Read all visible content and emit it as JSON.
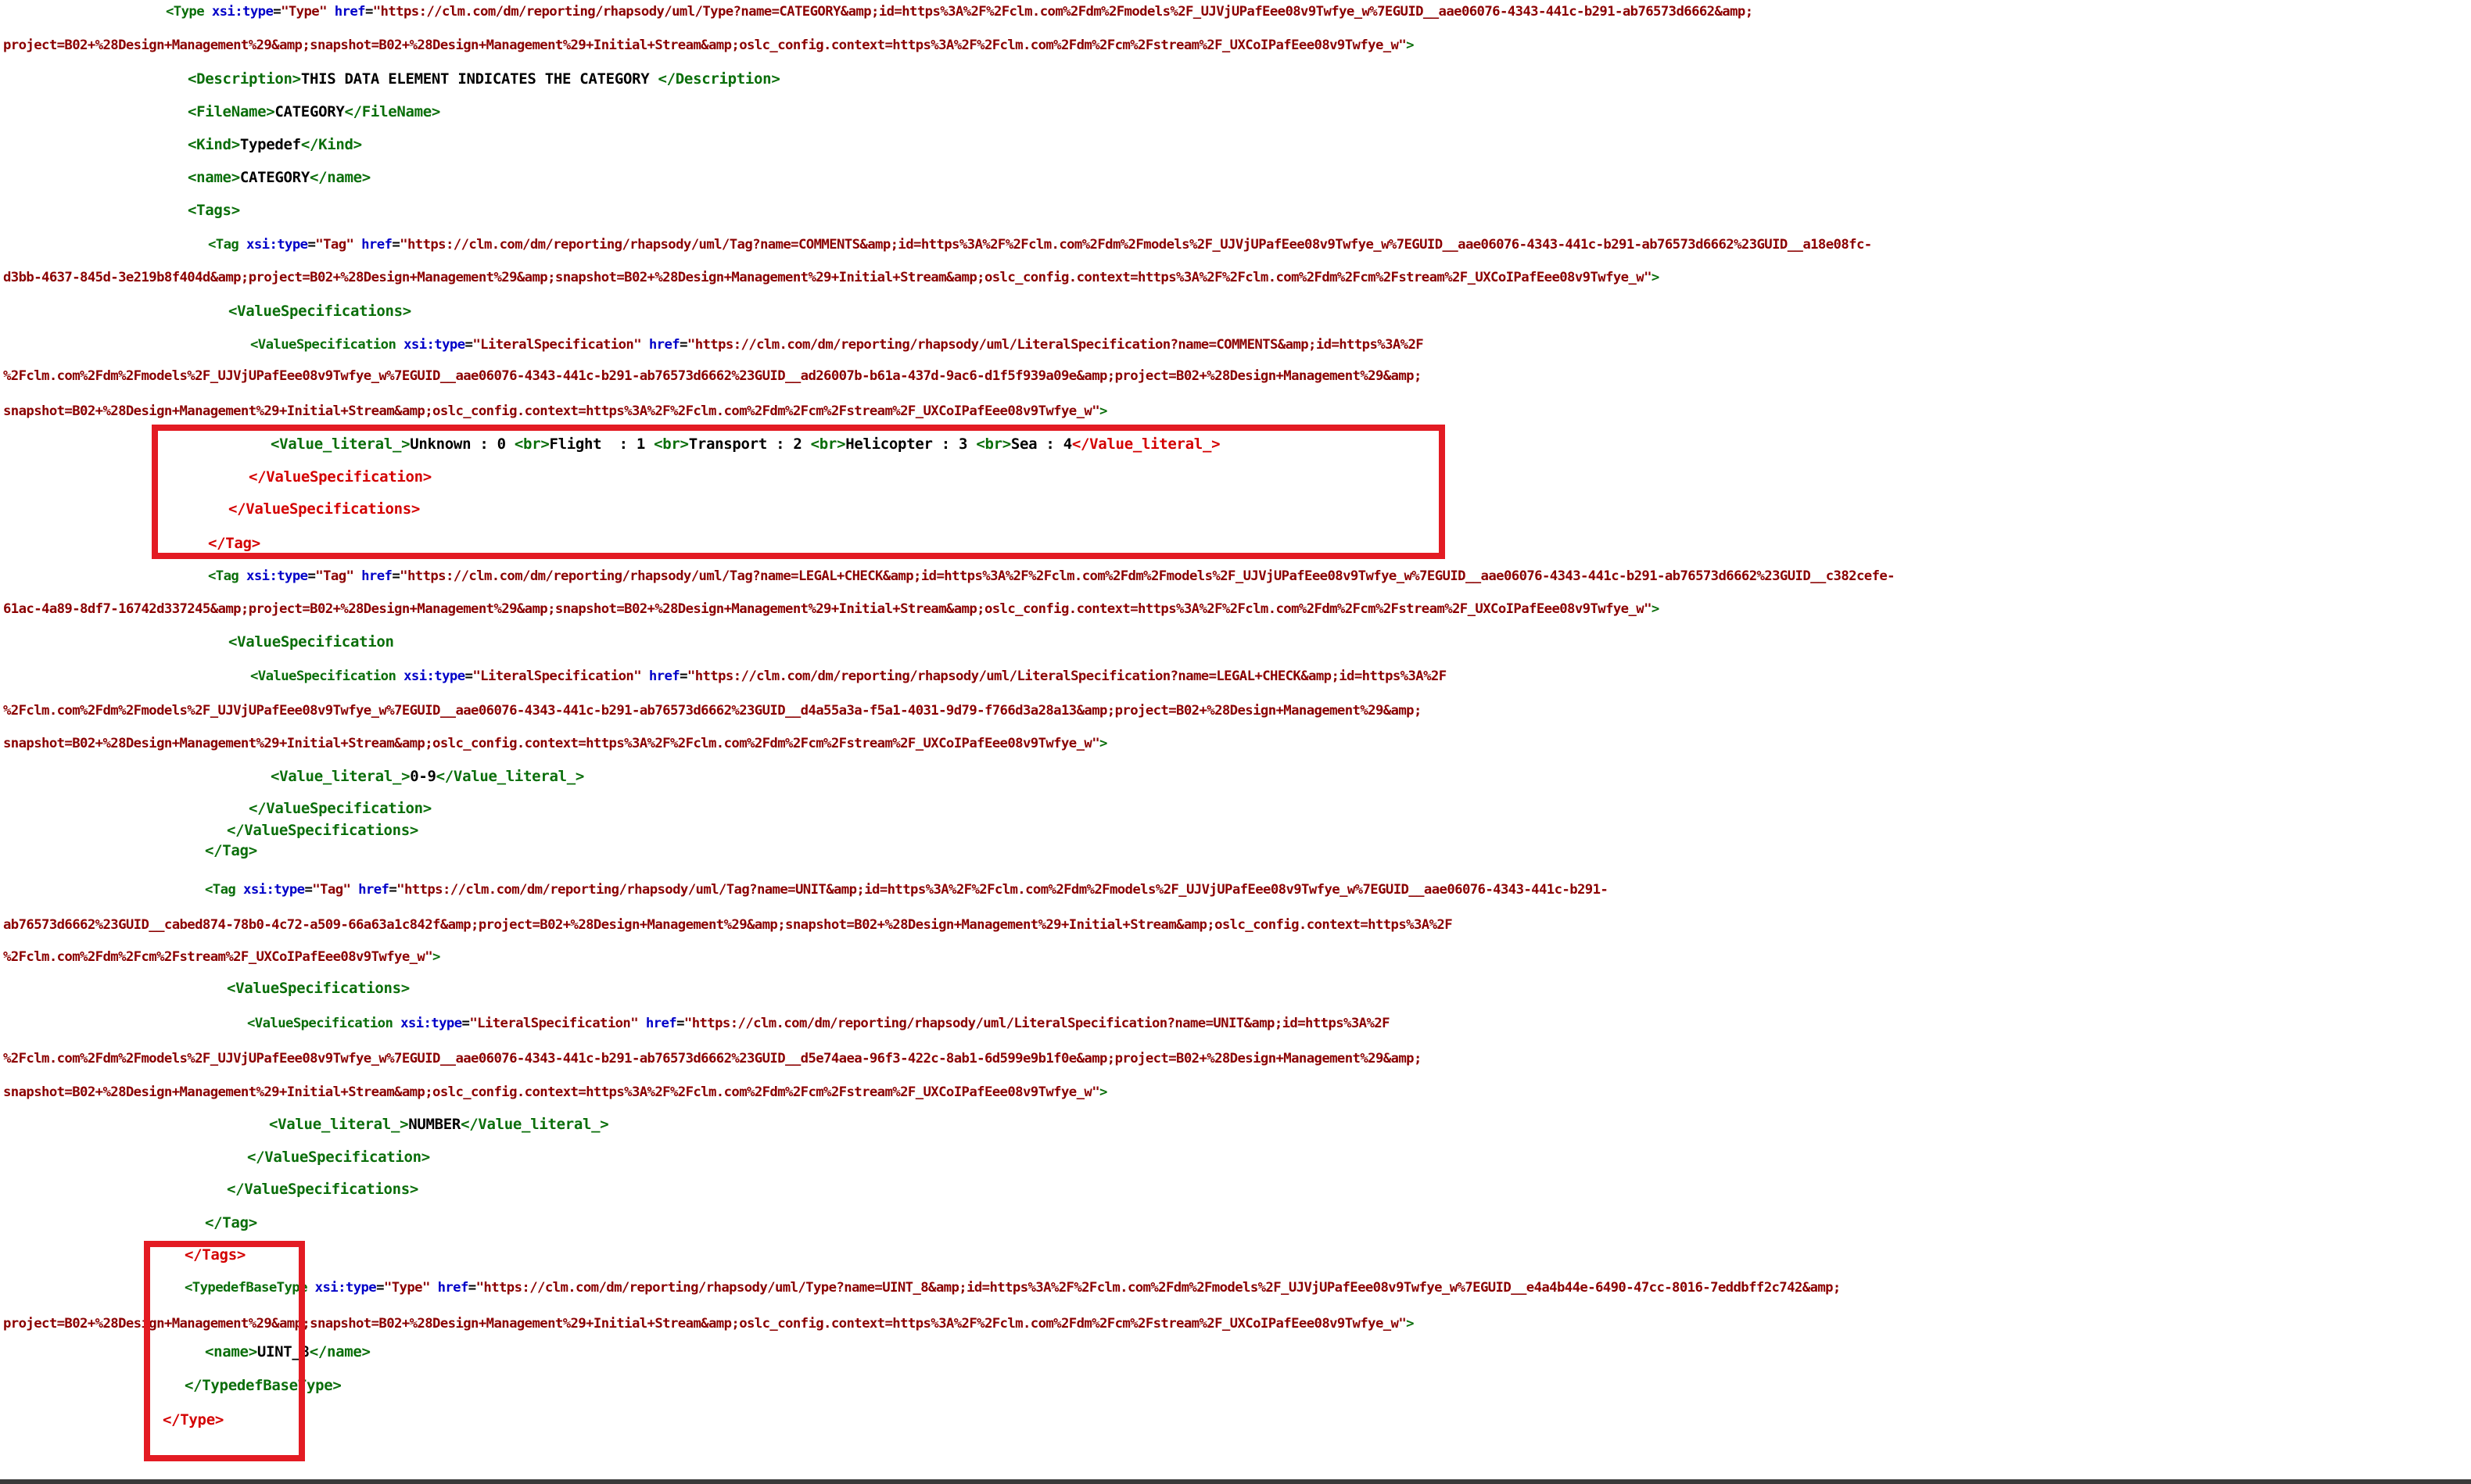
{
  "viewer": {
    "lines": [
      {
        "segs": [
          {
            "k": "tg",
            "t": "<Type "
          },
          {
            "k": "an",
            "t": "xsi:type"
          },
          {
            "k": "tx",
            "t": "="
          },
          {
            "k": "av",
            "t": "\"Type\""
          },
          {
            "k": "tx",
            "t": " "
          },
          {
            "k": "an",
            "t": "href"
          },
          {
            "k": "tx",
            "t": "="
          },
          {
            "k": "av",
            "t": "\"https://clm.com/dm/reporting/rhapsody/uml/Type?name=CATEGORY&amp;id=https%3A%2F%2Fclm.com%2Fdm%2Fmodels%2F_UJVjUPafEee08v9Twfye_w%7EGUID__aae06076-4343-441c-b291-ab76573d6662&amp;"
          }
        ]
      },
      {
        "segs": [
          {
            "k": "av",
            "t": "project=B02+%28Design+Management%29&amp;snapshot=B02+%28Design+Management%29+Initial+Stream&amp;oslc_config.context=https%3A%2F%2Fclm.com%2Fdm%2Fcm%2Fstream%2F_UXCoIPafEee08v9Twfye_w\""
          },
          {
            "k": "tg",
            "t": ">"
          }
        ]
      },
      {
        "segs": [
          {
            "k": "tg",
            "t": "<Description>"
          },
          {
            "k": "tx",
            "t": "THIS DATA ELEMENT INDICATES THE CATEGORY "
          },
          {
            "k": "tg",
            "t": "</Description>"
          }
        ]
      },
      {
        "segs": [
          {
            "k": "tg",
            "t": "<FileName>"
          },
          {
            "k": "tx",
            "t": "CATEGORY"
          },
          {
            "k": "tg",
            "t": "</FileName>"
          }
        ]
      },
      {
        "segs": [
          {
            "k": "tg",
            "t": "<Kind>"
          },
          {
            "k": "tx",
            "t": "Typedef"
          },
          {
            "k": "tg",
            "t": "</Kind>"
          }
        ]
      },
      {
        "segs": [
          {
            "k": "tg",
            "t": "<name>"
          },
          {
            "k": "tx",
            "t": "CATEGORY"
          },
          {
            "k": "tg",
            "t": "</name>"
          }
        ]
      },
      {
        "segs": [
          {
            "k": "tg",
            "t": "<Tags>"
          }
        ]
      },
      {
        "segs": [
          {
            "k": "tg",
            "t": "<Tag "
          },
          {
            "k": "an",
            "t": "xsi:type"
          },
          {
            "k": "tx",
            "t": "="
          },
          {
            "k": "av",
            "t": "\"Tag\""
          },
          {
            "k": "tx",
            "t": " "
          },
          {
            "k": "an",
            "t": "href"
          },
          {
            "k": "tx",
            "t": "="
          },
          {
            "k": "av",
            "t": "\"https://clm.com/dm/reporting/rhapsody/uml/Tag?name=COMMENTS&amp;id=https%3A%2F%2Fclm.com%2Fdm%2Fmodels%2F_UJVjUPafEee08v9Twfye_w%7EGUID__aae06076-4343-441c-b291-ab76573d6662%23GUID__a18e08fc-"
          }
        ]
      },
      {
        "segs": [
          {
            "k": "av",
            "t": "d3bb-4637-845d-3e219b8f404d&amp;project=B02+%28Design+Management%29&amp;snapshot=B02+%28Design+Management%29+Initial+Stream&amp;oslc_config.context=https%3A%2F%2Fclm.com%2Fdm%2Fcm%2Fstream%2F_UXCoIPafEee08v9Twfye_w\""
          },
          {
            "k": "tg",
            "t": ">"
          }
        ]
      },
      {
        "segs": [
          {
            "k": "tg",
            "t": "<ValueSpecifications>"
          }
        ]
      },
      {
        "segs": [
          {
            "k": "tg",
            "t": "<ValueSpecification "
          },
          {
            "k": "an",
            "t": "xsi:type"
          },
          {
            "k": "tx",
            "t": "="
          },
          {
            "k": "av",
            "t": "\"LiteralSpecification\""
          },
          {
            "k": "tx",
            "t": " "
          },
          {
            "k": "an",
            "t": "href"
          },
          {
            "k": "tx",
            "t": "="
          },
          {
            "k": "av",
            "t": "\"https://clm.com/dm/reporting/rhapsody/uml/LiteralSpecification?name=COMMENTS&amp;id=https%3A%2F"
          }
        ]
      },
      {
        "segs": [
          {
            "k": "av",
            "t": "%2Fclm.com%2Fdm%2Fmodels%2F_UJVjUPafEee08v9Twfye_w%7EGUID__aae06076-4343-441c-b291-ab76573d6662%23GUID__ad26007b-b61a-437d-9ac6-d1f5f939a09e&amp;project=B02+%28Design+Management%29&amp;"
          }
        ]
      },
      {
        "segs": [
          {
            "k": "av",
            "t": "snapshot=B02+%28Design+Management%29+Initial+Stream&amp;oslc_config.context=https%3A%2F%2Fclm.com%2Fdm%2Fcm%2Fstream%2F_UXCoIPafEee08v9Twfye_w\""
          },
          {
            "k": "tg",
            "t": ">"
          }
        ]
      },
      {
        "segs": [
          {
            "k": "tg",
            "t": "<Value_literal_>"
          },
          {
            "k": "tx",
            "t": "Unknown : 0 "
          },
          {
            "k": "tg",
            "t": "<br>"
          },
          {
            "k": "tx",
            "t": "Flight  : 1 "
          },
          {
            "k": "tg",
            "t": "<br>"
          },
          {
            "k": "tx",
            "t": "Transport : 2 "
          },
          {
            "k": "tg",
            "t": "<br>"
          },
          {
            "k": "tx",
            "t": "Helicopter : 3 "
          },
          {
            "k": "tg",
            "t": "<br>"
          },
          {
            "k": "tx",
            "t": "Sea : 4"
          },
          {
            "k": "tgc",
            "t": "</Value_literal_>"
          }
        ]
      },
      {
        "segs": [
          {
            "k": "tgc",
            "t": "</ValueSpecification>"
          }
        ]
      },
      {
        "segs": [
          {
            "k": "tgc",
            "t": "</ValueSpecifications>"
          }
        ]
      },
      {
        "segs": [
          {
            "k": "tgc",
            "t": "</Tag>"
          }
        ]
      },
      {
        "segs": [
          {
            "k": "tg",
            "t": "<Tag "
          },
          {
            "k": "an",
            "t": "xsi:type"
          },
          {
            "k": "tx",
            "t": "="
          },
          {
            "k": "av",
            "t": "\"Tag\""
          },
          {
            "k": "tx",
            "t": " "
          },
          {
            "k": "an",
            "t": "href"
          },
          {
            "k": "tx",
            "t": "="
          },
          {
            "k": "av",
            "t": "\"https://clm.com/dm/reporting/rhapsody/uml/Tag?name=LEGAL+CHECK&amp;id=https%3A%2F%2Fclm.com%2Fdm%2Fmodels%2F_UJVjUPafEee08v9Twfye_w%7EGUID__aae06076-4343-441c-b291-ab76573d6662%23GUID__c382cefe-"
          }
        ]
      },
      {
        "segs": [
          {
            "k": "av",
            "t": "61ac-4a89-8df7-16742d337245&amp;project=B02+%28Design+Management%29&amp;snapshot=B02+%28Design+Management%29+Initial+Stream&amp;oslc_config.context=https%3A%2F%2Fclm.com%2Fdm%2Fcm%2Fstream%2F_UXCoIPafEee08v9Twfye_w\""
          },
          {
            "k": "tg",
            "t": ">"
          }
        ]
      },
      {
        "segs": [
          {
            "k": "tg",
            "t": "<ValueSpecification"
          }
        ]
      },
      {
        "segs": [
          {
            "k": "tg",
            "t": "<ValueSpecification "
          },
          {
            "k": "an",
            "t": "xsi:type"
          },
          {
            "k": "tx",
            "t": "="
          },
          {
            "k": "av",
            "t": "\"LiteralSpecification\""
          },
          {
            "k": "tx",
            "t": " "
          },
          {
            "k": "an",
            "t": "href"
          },
          {
            "k": "tx",
            "t": "="
          },
          {
            "k": "av",
            "t": "\"https://clm.com/dm/reporting/rhapsody/uml/LiteralSpecification?name=LEGAL+CHECK&amp;id=https%3A%2F"
          }
        ]
      },
      {
        "segs": [
          {
            "k": "av",
            "t": "%2Fclm.com%2Fdm%2Fmodels%2F_UJVjUPafEee08v9Twfye_w%7EGUID__aae06076-4343-441c-b291-ab76573d6662%23GUID__d4a55a3a-f5a1-4031-9d79-f766d3a28a13&amp;project=B02+%28Design+Management%29&amp;"
          }
        ]
      },
      {
        "segs": [
          {
            "k": "av",
            "t": "snapshot=B02+%28Design+Management%29+Initial+Stream&amp;oslc_config.context=https%3A%2F%2Fclm.com%2Fdm%2Fcm%2Fstream%2F_UXCoIPafEee08v9Twfye_w\""
          },
          {
            "k": "tg",
            "t": ">"
          }
        ]
      },
      {
        "segs": [
          {
            "k": "tg",
            "t": "<Value_literal_>"
          },
          {
            "k": "tx",
            "t": "0-9"
          },
          {
            "k": "tg",
            "t": "</Value_literal_>"
          }
        ]
      },
      {
        "segs": [
          {
            "k": "tg",
            "t": "</ValueSpecification>"
          }
        ]
      },
      {
        "segs": [
          {
            "k": "tg",
            "t": "</ValueSpecifications>"
          }
        ]
      },
      {
        "segs": [
          {
            "k": "tg",
            "t": "</Tag>"
          }
        ]
      },
      {
        "segs": [
          {
            "k": "tg",
            "t": "<Tag "
          },
          {
            "k": "an",
            "t": "xsi:type"
          },
          {
            "k": "tx",
            "t": "="
          },
          {
            "k": "av",
            "t": "\"Tag\""
          },
          {
            "k": "tx",
            "t": " "
          },
          {
            "k": "an",
            "t": "href"
          },
          {
            "k": "tx",
            "t": "="
          },
          {
            "k": "av",
            "t": "\"https://clm.com/dm/reporting/rhapsody/uml/Tag?name=UNIT&amp;id=https%3A%2F%2Fclm.com%2Fdm%2Fmodels%2F_UJVjUPafEee08v9Twfye_w%7EGUID__aae06076-4343-441c-b291-"
          }
        ]
      },
      {
        "segs": [
          {
            "k": "av",
            "t": "ab76573d6662%23GUID__cabed874-78b0-4c72-a509-66a63a1c842f&amp;project=B02+%28Design+Management%29&amp;snapshot=B02+%28Design+Management%29+Initial+Stream&amp;oslc_config.context=https%3A%2F"
          }
        ]
      },
      {
        "segs": [
          {
            "k": "av",
            "t": "%2Fclm.com%2Fdm%2Fcm%2Fstream%2F_UXCoIPafEee08v9Twfye_w\""
          },
          {
            "k": "tg",
            "t": ">"
          }
        ]
      },
      {
        "segs": [
          {
            "k": "tg",
            "t": "<ValueSpecifications>"
          }
        ]
      },
      {
        "segs": [
          {
            "k": "tg",
            "t": "<ValueSpecification "
          },
          {
            "k": "an",
            "t": "xsi:type"
          },
          {
            "k": "tx",
            "t": "="
          },
          {
            "k": "av",
            "t": "\"LiteralSpecification\""
          },
          {
            "k": "tx",
            "t": " "
          },
          {
            "k": "an",
            "t": "href"
          },
          {
            "k": "tx",
            "t": "="
          },
          {
            "k": "av",
            "t": "\"https://clm.com/dm/reporting/rhapsody/uml/LiteralSpecification?name=UNIT&amp;id=https%3A%2F"
          }
        ]
      },
      {
        "segs": [
          {
            "k": "av",
            "t": "%2Fclm.com%2Fdm%2Fmodels%2F_UJVjUPafEee08v9Twfye_w%7EGUID__aae06076-4343-441c-b291-ab76573d6662%23GUID__d5e74aea-96f3-422c-8ab1-6d599e9b1f0e&amp;project=B02+%28Design+Management%29&amp;"
          }
        ]
      },
      {
        "segs": [
          {
            "k": "av",
            "t": "snapshot=B02+%28Design+Management%29+Initial+Stream&amp;oslc_config.context=https%3A%2F%2Fclm.com%2Fdm%2Fcm%2Fstream%2F_UXCoIPafEee08v9Twfye_w\""
          },
          {
            "k": "tg",
            "t": ">"
          }
        ]
      },
      {
        "segs": [
          {
            "k": "tg",
            "t": "<Value_literal_>"
          },
          {
            "k": "tx",
            "t": "NUMBER"
          },
          {
            "k": "tg",
            "t": "</Value_literal_>"
          }
        ]
      },
      {
        "segs": [
          {
            "k": "tg",
            "t": "</ValueSpecification>"
          }
        ]
      },
      {
        "segs": [
          {
            "k": "tg",
            "t": "</ValueSpecifications>"
          }
        ]
      },
      {
        "segs": [
          {
            "k": "tg",
            "t": "</Tag>"
          }
        ]
      },
      {
        "segs": [
          {
            "k": "tgc",
            "t": "</Tags>"
          }
        ]
      },
      {
        "segs": [
          {
            "k": "tg",
            "t": "<TypedefBaseType "
          },
          {
            "k": "an",
            "t": "xsi:type"
          },
          {
            "k": "tx",
            "t": "="
          },
          {
            "k": "av",
            "t": "\"Type\""
          },
          {
            "k": "tx",
            "t": " "
          },
          {
            "k": "an",
            "t": "href"
          },
          {
            "k": "tx",
            "t": "="
          },
          {
            "k": "av",
            "t": "\"https://clm.com/dm/reporting/rhapsody/uml/Type?name=UINT_8&amp;id=https%3A%2F%2Fclm.com%2Fdm%2Fmodels%2F_UJVjUPafEee08v9Twfye_w%7EGUID__e4a4b44e-6490-47cc-8016-7eddbff2c742&amp;"
          }
        ]
      },
      {
        "segs": [
          {
            "k": "av",
            "t": "project=B02+%28Design+Management%29&amp;snapshot=B02+%28Design+Management%29+Initial+Stream&amp;oslc_config.context=https%3A%2F%2Fclm.com%2Fdm%2Fcm%2Fstream%2F_UXCoIPafEee08v9Twfye_w\""
          },
          {
            "k": "tg",
            "t": ">"
          }
        ]
      },
      {
        "segs": [
          {
            "k": "tg",
            "t": "<name>"
          },
          {
            "k": "tx",
            "t": "UINT_8"
          },
          {
            "k": "tg",
            "t": "</name>"
          }
        ]
      },
      {
        "segs": [
          {
            "k": "tg",
            "t": "</TypedefBaseType>"
          }
        ]
      },
      {
        "segs": [
          {
            "k": "tgc",
            "t": "</Type>"
          }
        ]
      }
    ]
  }
}
